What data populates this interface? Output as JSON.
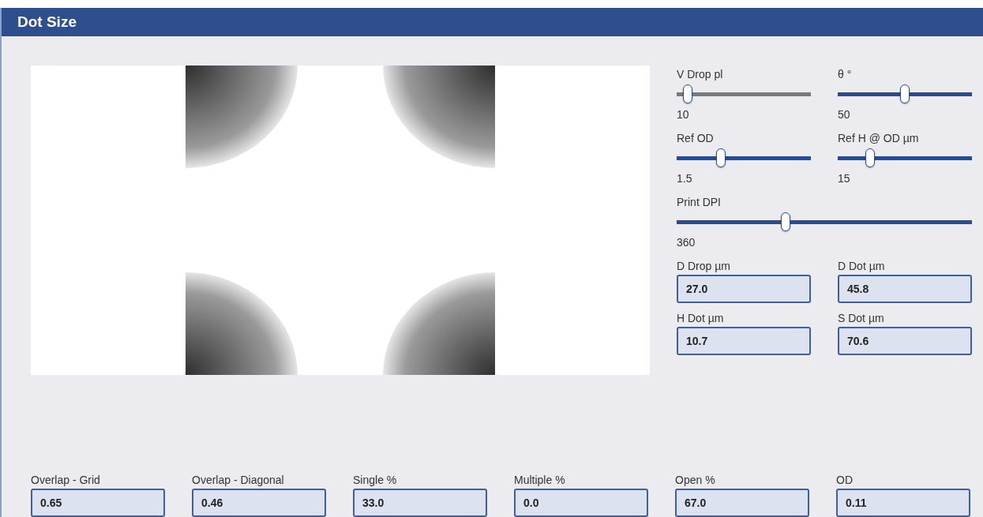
{
  "window": {
    "title": "Dot Size"
  },
  "sliders": [
    {
      "label": "V Drop pl",
      "level": 0.08,
      "disabled": true,
      "reading": "10"
    },
    {
      "label": "θ °",
      "level": 0.5,
      "disabled": false,
      "reading": "50"
    },
    {
      "label": "Ref OD",
      "level": 0.33,
      "disabled": false,
      "reading": "1.5"
    },
    {
      "label": "Ref H @ OD µm",
      "level": 0.24,
      "disabled": false,
      "reading": "15"
    },
    {
      "label": "Print DPI",
      "level": 0.37,
      "disabled": false,
      "reading": "360"
    }
  ],
  "outputs": [
    {
      "label": "D Drop µm",
      "value": "27.0"
    },
    {
      "label": "D Dot µm",
      "value": "45.8"
    },
    {
      "label": "H Dot µm",
      "value": "10.7"
    },
    {
      "label": "S Dot µm",
      "value": "70.6"
    }
  ],
  "results": [
    {
      "label": "Overlap - Grid",
      "value": "0.65"
    },
    {
      "label": "Overlap - Diagonal",
      "value": "0.46"
    },
    {
      "label": "Single %",
      "value": "33.0"
    },
    {
      "label": "Multiple %",
      "value": "0.0"
    },
    {
      "label": "Open %",
      "value": "67.0"
    },
    {
      "label": "OD",
      "value": "0.11"
    }
  ]
}
